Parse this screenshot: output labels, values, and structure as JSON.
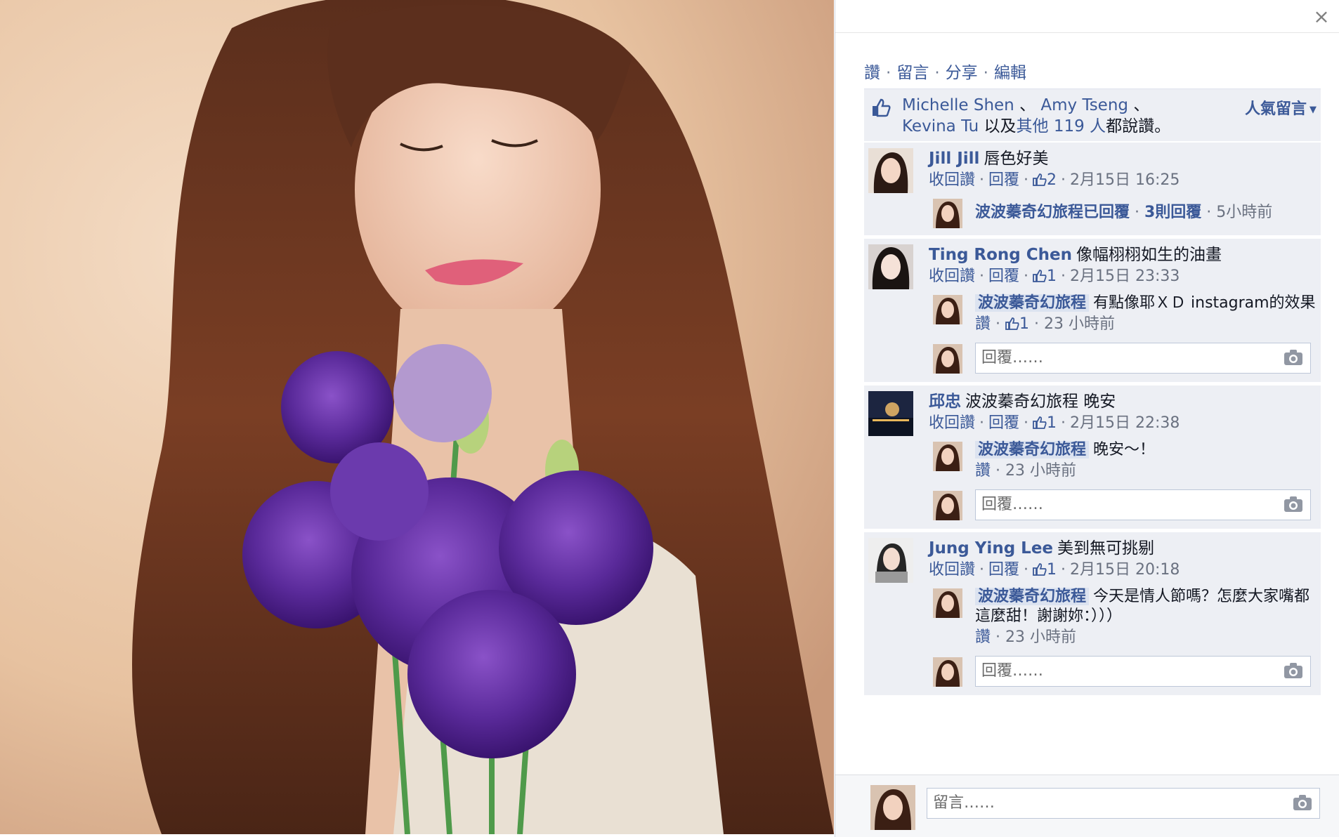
{
  "photo": {
    "description_icon": "photo-canvas"
  },
  "panel": {
    "close_icon": "close-icon",
    "actions": {
      "like": "讚",
      "comment": "留言",
      "share": "分享",
      "edit": "編輯"
    },
    "likes": {
      "name1": "Michelle Shen",
      "sep1": " 、 ",
      "name2": "Amy Tseng",
      "sep2": " 、",
      "name3": "Kevina Tu",
      "and": " 以及",
      "others": "其他 119 人",
      "tail": "都說讚。",
      "top_comments": "人氣留言"
    },
    "comments": [
      {
        "author": "Jill Jill",
        "text": "唇色好美",
        "unlike": "收回讚",
        "reply": "回覆",
        "likes": "2",
        "time": "2月15日 16:25",
        "summary": {
          "label": "波波蓁奇幻旅程已回覆",
          "count": "3則回覆",
          "time": "5小時前"
        }
      },
      {
        "author": "Ting Rong Chen",
        "text": "像幅栩栩如生的油畫",
        "unlike": "收回讚",
        "reply": "回覆",
        "likes": "1",
        "time": "2月15日 23:33",
        "reply_item": {
          "author": "波波蓁奇幻旅程",
          "text": "有點像耶ＸＤ instagram的效果",
          "like": "讚",
          "likes": "1",
          "time": "23 小時前"
        },
        "reply_placeholder": "回覆……"
      },
      {
        "author": "邱忠",
        "text": "波波蓁奇幻旅程 晚安",
        "unlike": "收回讚",
        "reply": "回覆",
        "likes": "1",
        "time": "2月15日 22:38",
        "reply_item": {
          "author": "波波蓁奇幻旅程",
          "text": "晚安～！",
          "like": "讚",
          "time": "23 小時前"
        },
        "reply_placeholder": "回覆……"
      },
      {
        "author": "Jung Ying Lee",
        "text": "美到無可挑剔",
        "unlike": "收回讚",
        "reply": "回覆",
        "likes": "1",
        "time": "2月15日 20:18",
        "reply_item": {
          "author": "波波蓁奇幻旅程",
          "text": "今天是情人節嗎？怎麼大家嘴都這麼甜！謝謝妳：）））",
          "like": "讚",
          "time": "23 小時前"
        },
        "reply_placeholder": "回覆……"
      }
    ],
    "comment_placeholder": "留言……"
  },
  "colors": {
    "link": "#3b5998",
    "panel_bg": "#edeff4",
    "muted": "#6a7180"
  }
}
